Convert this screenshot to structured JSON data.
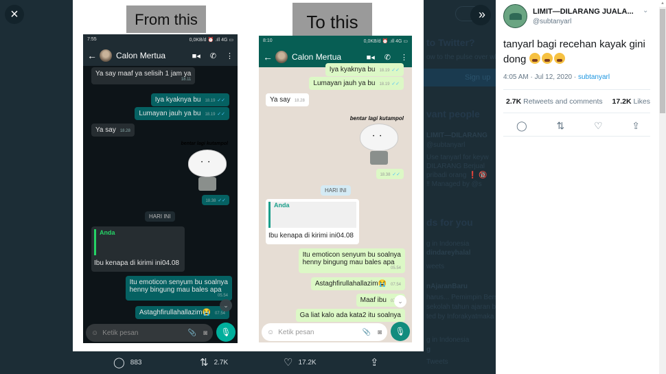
{
  "viewer": {
    "close_icon": "×",
    "expand_icon": "»"
  },
  "backdrop": {
    "join_heading": "to Twitter?",
    "join_sub": "ow to the pulse over wha",
    "signup_label": "Sign up",
    "relevant_heading": "vant people",
    "relevant_name": "LIMIT—DILARANG",
    "relevant_handle": "@subtanyarl",
    "relevant_bio": [
      "Use tanyarl for keyw",
      "DILARANG Berjual",
      "pribadi orang ❗ 🔞",
      "‼ Managed by @s"
    ],
    "trends_heading": "ds for you",
    "trend1_ctx": "g in Indonesia",
    "trend1": "dindareyhalal",
    "trend1_count": "weets",
    "trend2": "nAjaranBaru",
    "trend2_desc": [
      "harus... Pemimpin Bersama",
      "sekolah tahun ajaran b",
      "ted by Inforakyatmaka"
    ],
    "trend3_ctx": "g in Indonesia",
    "trend3": "g",
    "trend3_count": "Tweets"
  },
  "media": {
    "caption_from": "From this",
    "caption_to": "To this",
    "phones": [
      {
        "status_time": "7:55",
        "status_right": "0,0KB/d ⏰ .ıll 4G ▭",
        "contact": "Calon Mertua",
        "messages": [
          {
            "dir": "in",
            "text": "Ya say maaf ya selisih 1 jam ya",
            "time": "18.11"
          },
          {
            "dir": "out",
            "text": "Iya kyaknya bu",
            "time": "18.19"
          },
          {
            "dir": "out",
            "text": "Lumayan jauh ya bu",
            "time": "18.19"
          },
          {
            "dir": "in",
            "text": "Ya say",
            "time": "18.28"
          },
          {
            "dir": "out",
            "type": "sticker",
            "caption": "bentar lagi kutampol",
            "time": "18.38"
          },
          {
            "type": "date",
            "text": "HARI INI"
          },
          {
            "dir": "in",
            "type": "reply",
            "quoted_author": "Anda",
            "text": "Ibu kenapa di kirimi ini",
            "time": "04.08"
          },
          {
            "dir": "out",
            "text": "Itu emoticon senyum bu soalnya henny bingung mau bales apa",
            "line1": "Itu emoticon senyum bu soalnya",
            "line2": "henny bingung mau bales apa",
            "time": "05.54"
          },
          {
            "dir": "out",
            "text": "Astaghfirullahallazim😭",
            "time": "07.54"
          }
        ],
        "composer_placeholder": "Ketik pesan"
      },
      {
        "status_time": "8:10",
        "status_right": "0,0KB/d ⏰ .ıll 4G ▭",
        "contact": "Calon Mertua",
        "messages": [
          {
            "dir": "out",
            "text": "Iya kyaknya bu",
            "time": "18.19"
          },
          {
            "dir": "out",
            "text": "Lumayan jauh ya bu",
            "time": "18.19"
          },
          {
            "dir": "in",
            "text": "Ya say",
            "time": "18.28"
          },
          {
            "dir": "out",
            "type": "sticker",
            "caption": "bentar lagi kutampol",
            "time": "18.38"
          },
          {
            "type": "date",
            "text": "HARI INI"
          },
          {
            "dir": "in",
            "type": "reply",
            "quoted_author": "Anda",
            "text": "Ibu kenapa di kirimi ini",
            "time": "04.08"
          },
          {
            "dir": "out",
            "text": "Itu emoticon senyum bu soalnya henny bingung mau bales apa",
            "line1": "Itu emoticon senyum bu soalnya",
            "line2": "henny bingung mau bales apa",
            "time": "05.54"
          },
          {
            "dir": "out",
            "text": "Astaghfirullahallazim😭",
            "time": "07.54"
          },
          {
            "dir": "out",
            "text": "Maaf ibu",
            "time": "07.54"
          },
          {
            "dir": "out",
            "text": "Ga liat kalo ada kata2 itu soalnya",
            "time": ""
          }
        ],
        "composer_placeholder": "Ketik pesan"
      }
    ]
  },
  "media_actions": {
    "replies": "883",
    "retweets": "2.7K",
    "likes": "17.2K"
  },
  "tweet": {
    "author": "LIMIT—DILARANG JUALA...",
    "handle": "@subtanyarl",
    "text": "tanyarl bagi recehan kayak gini dong",
    "emoji_count": 3,
    "timestamp": "4:05 AM · Jul 12, 2020 · ",
    "source": "subtanyarl",
    "retweets_count": "2.7K",
    "retweets_label": "Retweets and comments",
    "likes_count": "17.2K",
    "likes_label": "Likes"
  }
}
